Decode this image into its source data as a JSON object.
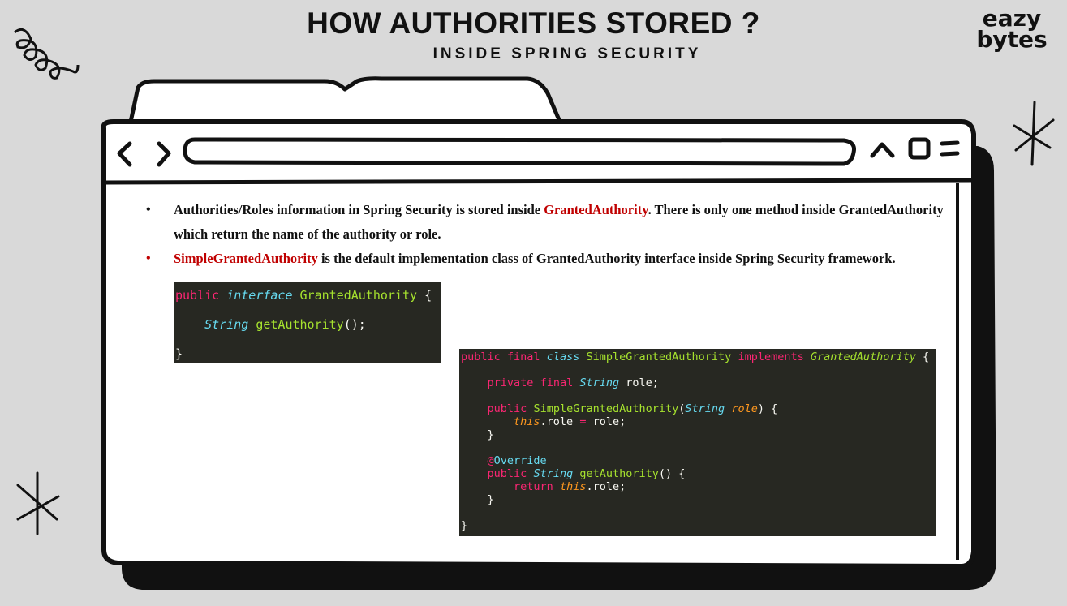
{
  "header": {
    "title": "HOW AUTHORITIES STORED ?",
    "subtitle": "INSIDE SPRING SECURITY"
  },
  "logo": {
    "line1": "eazy",
    "line2": "bytes"
  },
  "browser": {
    "icons": [
      "chevron-left-icon",
      "chevron-right-icon",
      "chevron-up-icon",
      "square-icon",
      "menu-icon"
    ]
  },
  "bullets": [
    {
      "text_before": "Authorities/Roles information in Spring Security is stored inside ",
      "highlight": "GrantedAuthority",
      "text_after": ". There is only one method inside GrantedAuthority which return the name of the authority or role."
    },
    {
      "highlight": "SimpleGrantedAuthority",
      "text_after": " is the default implementation class of GrantedAuthority interface inside Spring Security framework."
    }
  ],
  "code1": {
    "kw_public": "public",
    "kw_interface": "interface",
    "name": "GrantedAuthority",
    "open": "{",
    "return_type": "String",
    "method": "getAuthority",
    "method_tail": "();",
    "close": "}"
  },
  "code2": {
    "l1_public": "public",
    "l1_final": "final",
    "l1_class": "class",
    "l1_name": "SimpleGrantedAuthority",
    "l1_implements": "implements",
    "l1_iface": "GrantedAuthority",
    "l1_open": "{",
    "l2_private": "private",
    "l2_final": "final",
    "l2_type": "String",
    "l2_rest": "role;",
    "l3_public": "public",
    "l3_name": "SimpleGrantedAuthority",
    "l3_paren": "(",
    "l3_type": "String",
    "l3_param": "role",
    "l3_tail": ") {",
    "l4_this": "this",
    "l4_rest1": ".role ",
    "l4_eq": "=",
    "l4_rest2": " role;",
    "l5_close": "}",
    "l6_at": "@",
    "l6_override": "Override",
    "l7_public": "public",
    "l7_type": "String",
    "l7_method": "getAuthority",
    "l7_tail": "() {",
    "l8_return": "return",
    "l8_this": "this",
    "l8_rest": ".role;",
    "l9_close": "}",
    "l10_close": "}"
  },
  "colors": {
    "background": "#d9d9d9",
    "accent_red": "#c00000",
    "code_bg": "#272822"
  }
}
